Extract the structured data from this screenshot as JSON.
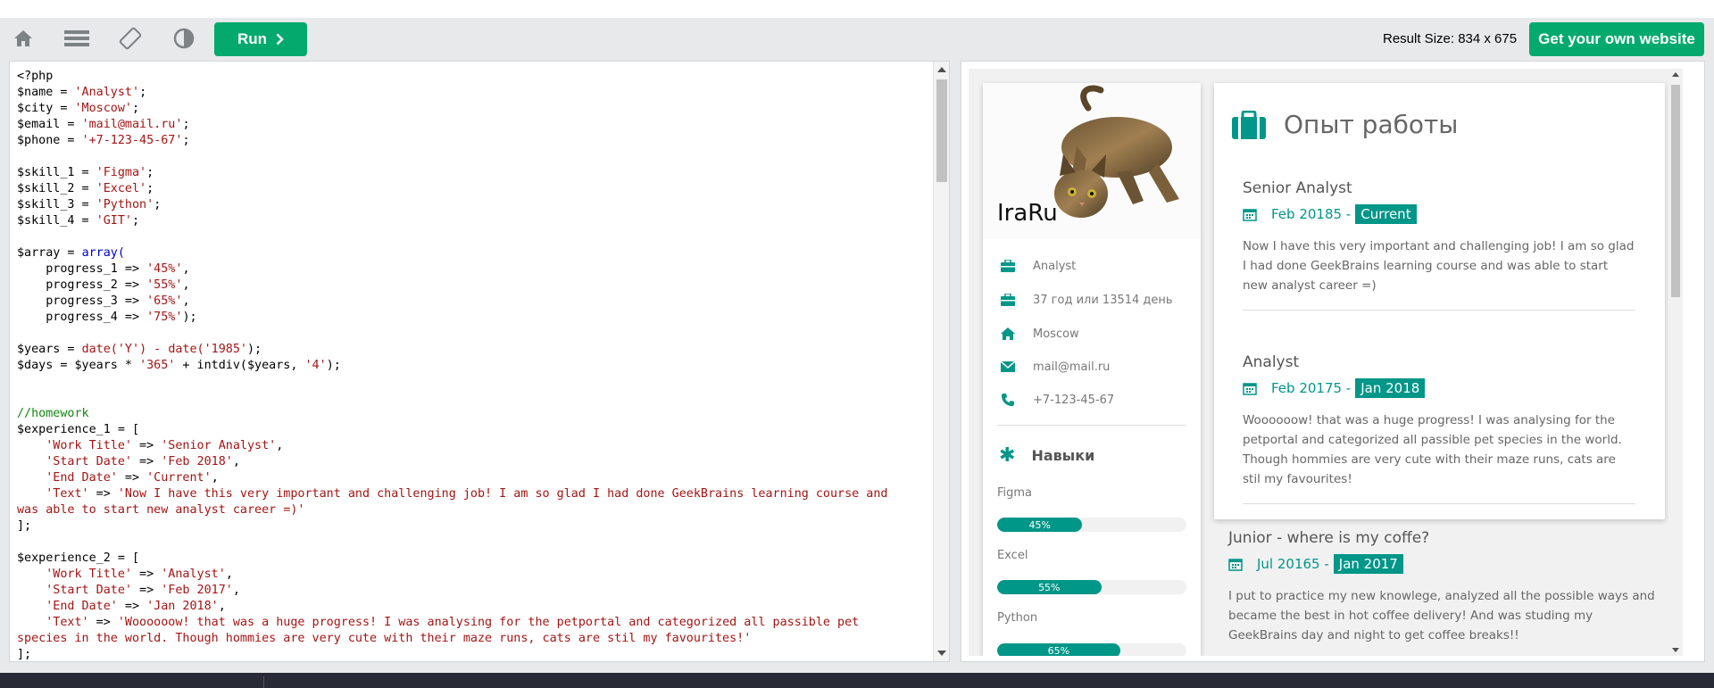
{
  "toolbar": {
    "run_label": "Run",
    "result_size": "Result Size: 834 x 675",
    "own_site_label": "Get your own website"
  },
  "code_lines": [
    [
      {
        "t": "<?php"
      }
    ],
    [
      {
        "t": "$name = "
      },
      {
        "t": "'Analyst'",
        "c": "s"
      },
      {
        "t": ";"
      }
    ],
    [
      {
        "t": "$city = "
      },
      {
        "t": "'Moscow'",
        "c": "s"
      },
      {
        "t": ";"
      }
    ],
    [
      {
        "t": "$email = "
      },
      {
        "t": "'mail@mail.ru'",
        "c": "s"
      },
      {
        "t": ";"
      }
    ],
    [
      {
        "t": "$phone = "
      },
      {
        "t": "'+7-123-45-67'",
        "c": "s"
      },
      {
        "t": ";"
      }
    ],
    [
      {
        "t": ""
      }
    ],
    [
      {
        "t": "$skill_1 = "
      },
      {
        "t": "'Figma'",
        "c": "s"
      },
      {
        "t": ";"
      }
    ],
    [
      {
        "t": "$skill_2 = "
      },
      {
        "t": "'Excel'",
        "c": "s"
      },
      {
        "t": ";"
      }
    ],
    [
      {
        "t": "$skill_3 = "
      },
      {
        "t": "'Python'",
        "c": "s"
      },
      {
        "t": ";"
      }
    ],
    [
      {
        "t": "$skill_4 = "
      },
      {
        "t": "'GIT'",
        "c": "s"
      },
      {
        "t": ";"
      }
    ],
    [
      {
        "t": ""
      }
    ],
    [
      {
        "t": "$array = "
      },
      {
        "t": "array(",
        "c": "k"
      }
    ],
    [
      {
        "t": "    progress_1 => "
      },
      {
        "t": "'45%'",
        "c": "s"
      },
      {
        "t": ","
      }
    ],
    [
      {
        "t": "    progress_2 => "
      },
      {
        "t": "'55%'",
        "c": "s"
      },
      {
        "t": ","
      }
    ],
    [
      {
        "t": "    progress_3 => "
      },
      {
        "t": "'65%'",
        "c": "s"
      },
      {
        "t": ","
      }
    ],
    [
      {
        "t": "    progress_4 => "
      },
      {
        "t": "'75%'",
        "c": "s"
      },
      {
        "t": ");"
      }
    ],
    [
      {
        "t": ""
      }
    ],
    [
      {
        "t": "$years = "
      },
      {
        "t": "date(",
        "c": "s"
      },
      {
        "t": "'Y'",
        "c": "s"
      },
      {
        "t": ") - ",
        "c": "s"
      },
      {
        "t": "date(",
        "c": "s"
      },
      {
        "t": "'1985'",
        "c": "s"
      },
      {
        "t": ");"
      }
    ],
    [
      {
        "t": "$days = $years * "
      },
      {
        "t": "'365'",
        "c": "s"
      },
      {
        "t": " + intdiv($years, "
      },
      {
        "t": "'4'",
        "c": "s"
      },
      {
        "t": ");"
      }
    ],
    [
      {
        "t": ""
      }
    ],
    [
      {
        "t": ""
      }
    ],
    [
      {
        "t": "//homework",
        "c": "c"
      }
    ],
    [
      {
        "t": "$experience_1 = ["
      }
    ],
    [
      {
        "t": "    "
      },
      {
        "t": "'Work Title'",
        "c": "s"
      },
      {
        "t": " => "
      },
      {
        "t": "'Senior Analyst'",
        "c": "s"
      },
      {
        "t": ","
      }
    ],
    [
      {
        "t": "    "
      },
      {
        "t": "'Start Date'",
        "c": "s"
      },
      {
        "t": " => "
      },
      {
        "t": "'Feb 2018'",
        "c": "s"
      },
      {
        "t": ","
      }
    ],
    [
      {
        "t": "    "
      },
      {
        "t": "'End Date'",
        "c": "s"
      },
      {
        "t": " => "
      },
      {
        "t": "'Current'",
        "c": "s"
      },
      {
        "t": ","
      }
    ],
    [
      {
        "t": "    "
      },
      {
        "t": "'Text'",
        "c": "s"
      },
      {
        "t": " => "
      },
      {
        "t": "'Now I have this very important and challenging job! I am so glad I had done GeekBrains learning course and",
        "c": "s"
      }
    ],
    [
      {
        "t": "was able to start new analyst career =)'",
        "c": "s"
      }
    ],
    [
      {
        "t": "];"
      }
    ],
    [
      {
        "t": ""
      }
    ],
    [
      {
        "t": "$experience_2 = ["
      }
    ],
    [
      {
        "t": "    "
      },
      {
        "t": "'Work Title'",
        "c": "s"
      },
      {
        "t": " => "
      },
      {
        "t": "'Analyst'",
        "c": "s"
      },
      {
        "t": ","
      }
    ],
    [
      {
        "t": "    "
      },
      {
        "t": "'Start Date'",
        "c": "s"
      },
      {
        "t": " => "
      },
      {
        "t": "'Feb 2017'",
        "c": "s"
      },
      {
        "t": ","
      }
    ],
    [
      {
        "t": "    "
      },
      {
        "t": "'End Date'",
        "c": "s"
      },
      {
        "t": " => "
      },
      {
        "t": "'Jan 2018'",
        "c": "s"
      },
      {
        "t": ","
      }
    ],
    [
      {
        "t": "    "
      },
      {
        "t": "'Text'",
        "c": "s"
      },
      {
        "t": " => "
      },
      {
        "t": "'Woooooow! that was a huge progress! I was analysing for the petportal and categorized all passible pet",
        "c": "s"
      }
    ],
    [
      {
        "t": "species in the world. Though hommies are very cute with their maze runs, cats are stil my favourites!'",
        "c": "s"
      }
    ],
    [
      {
        "t": "];"
      }
    ]
  ],
  "profile": {
    "name": "IraRu",
    "job": "Analyst",
    "age": "37 год или 13514 день",
    "city": "Moscow",
    "email": "mail@mail.ru",
    "phone": "+7-123-45-67"
  },
  "skills": {
    "title": "Навыки",
    "items": [
      {
        "name": "Figma",
        "level": "45%"
      },
      {
        "name": "Excel",
        "level": "55%"
      },
      {
        "name": "Python",
        "level": "65%"
      }
    ]
  },
  "experience": {
    "title": "Опыт работы",
    "jobs": [
      {
        "title": "Senior Analyst",
        "start": "Feb 20185 -",
        "end": "Current",
        "text": "Now I have this very important and challenging job! I am so glad I had done GeekBrains learning course and was able to start new analyst career =)"
      },
      {
        "title": "Analyst",
        "start": "Feb 20175 -",
        "end": "Jan 2018",
        "text": "Woooooow! that was a huge progress! I was analysing for the petportal and categorized all passible pet species in the world. Though hommies are very cute with their maze runs, cats are stil my favourites!"
      },
      {
        "title": "Junior - where is my coffe?",
        "start": "Jul 20165 -",
        "end": "Jan 2017",
        "text": "I put to practice my new knowlege, analyzed all the possible ways and became the best in hot coffee delivery! And was studing my GeekBrains day and night to get coffee breaks!!"
      }
    ]
  },
  "colors": {
    "accent": "#04aa6d",
    "teal": "#009688"
  }
}
